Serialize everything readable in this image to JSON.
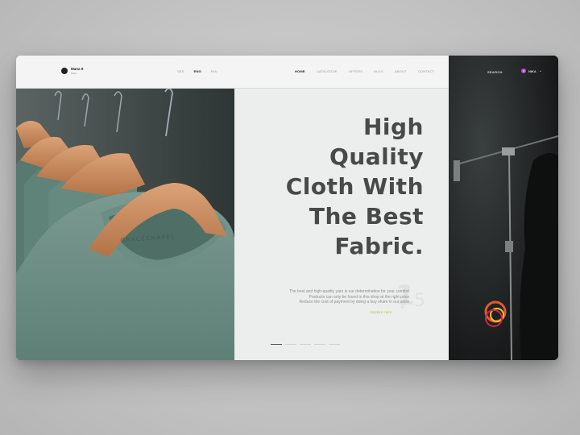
{
  "header": {
    "logo": {
      "name": "Mana It",
      "tag": "Store"
    },
    "languages": [
      {
        "label": "SES",
        "active": false
      },
      {
        "label": "ENG",
        "active": true
      },
      {
        "label": "RIA",
        "active": false
      }
    ],
    "nav": [
      {
        "label": "HOME",
        "active": true
      },
      {
        "label": "CATALOGUE",
        "active": false
      },
      {
        "label": "OFFERS",
        "active": false
      },
      {
        "label": "BLOG",
        "active": false
      },
      {
        "label": "ABOUT",
        "active": false
      },
      {
        "label": "CONTACT",
        "active": false
      }
    ],
    "search_label": "SEARCH",
    "user": {
      "initial": "M",
      "name": "NIKA"
    }
  },
  "hero": {
    "headline_lines": [
      "High",
      "Quality",
      "Cloth With",
      "The Best",
      "Fabric."
    ],
    "description_lines": [
      "The best and high-quality yarn is our determination for your comfort",
      "Products can only be found in this shop at the right price",
      "Reduce the cost of payment by doing a buy share in our store"
    ],
    "explore_label": "Explore Here",
    "counter": {
      "current": "1",
      "total": "5"
    },
    "slider_dots": [
      true,
      false,
      false,
      false,
      false
    ],
    "shirt_brand": "GRACECHAPEL"
  },
  "colors": {
    "accent": "#b8c44a",
    "shirt": "#6f8f86",
    "hanger": "#c98d5f",
    "avatar": "#b24fd0"
  }
}
